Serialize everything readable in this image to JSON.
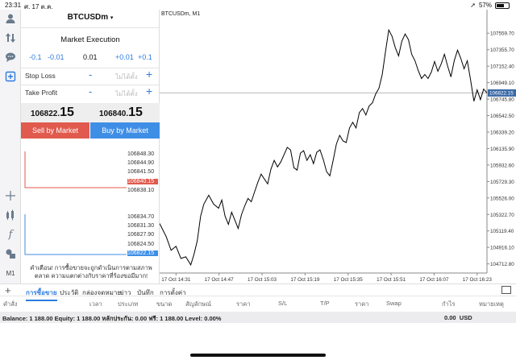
{
  "status_bar": {
    "time": "23:31",
    "date": "ศ. 17 ต.ค.",
    "battery": "57%",
    "battery_level": 0.57
  },
  "toolbar": {
    "timeframe_label": "M1"
  },
  "order_panel": {
    "symbol": "BTCUSDm",
    "caret": "▾",
    "execution": "Market Execution",
    "volume": {
      "dec_big": "-0.1",
      "dec_small": "-0.01",
      "value": "0.01",
      "inc_small": "+0.01",
      "inc_big": "+0.1"
    },
    "stop_loss": {
      "label": "Stop Loss",
      "minus": "-",
      "placeholder": "ไม่ได้ตั้ง",
      "plus": "+"
    },
    "take_profit": {
      "label": "Take Profit",
      "minus": "-",
      "placeholder": "ไม่ได้ตั้ง",
      "plus": "+"
    },
    "bid": {
      "main": "106822.",
      "big": "15"
    },
    "ask": {
      "main": "106840.",
      "big": "15"
    },
    "sell_button": "Sell by Market",
    "buy_button": "Buy by Market",
    "ask_ticks": [
      "106848.30",
      "106844.90",
      "106841.50",
      "106840.15",
      "106838.10"
    ],
    "bid_ticks": [
      "106834.70",
      "106831.30",
      "106827.90",
      "106824.50",
      "106822.15"
    ],
    "warning": "คำเตือน! การซื้อขายจะถูกดำเนินการตามสภาพตลาด ความแตกต่างกับราคาที่ร้องขอมีมาก!"
  },
  "chart": {
    "title": "BTCUSDm, M1",
    "current_price_label": "106822.15",
    "colors": {
      "line": "#000000",
      "price_line": "#b9b9b9",
      "price_tag": "#3b6aa8"
    }
  },
  "chart_data": {
    "type": "line",
    "title": "BTCUSDm, M1",
    "y_ticks": [
      "107559.70",
      "107355.70",
      "107152.40",
      "106949.10",
      "106745.80",
      "106542.50",
      "106339.20",
      "106135.90",
      "105932.60",
      "105729.30",
      "105526.00",
      "105322.70",
      "105119.40",
      "104916.10",
      "104712.80"
    ],
    "x_ticks": [
      "17 Oct 14:31",
      "17 Oct 14:47",
      "17 Oct 15:03",
      "17 Oct 15:19",
      "17 Oct 15:35",
      "17 Oct 15:51",
      "17 Oct 16:07",
      "17 Oct 16:23"
    ],
    "ylim": [
      104600,
      107850
    ],
    "x_range": [
      0,
      100
    ],
    "series": [
      {
        "values": [
          [
            0,
            105210
          ],
          [
            2,
            105050
          ],
          [
            3.5,
            104880
          ],
          [
            5,
            104930
          ],
          [
            6.5,
            104780
          ],
          [
            8,
            104800
          ],
          [
            9.5,
            104700
          ],
          [
            10.5,
            104830
          ],
          [
            11.5,
            105000
          ],
          [
            12.5,
            105300
          ],
          [
            13.5,
            105450
          ],
          [
            15,
            105560
          ],
          [
            16.5,
            105450
          ],
          [
            18,
            105400
          ],
          [
            19,
            105500
          ],
          [
            20,
            105300
          ],
          [
            21,
            105200
          ],
          [
            22,
            105350
          ],
          [
            23,
            105250
          ],
          [
            24,
            105150
          ],
          [
            25,
            105320
          ],
          [
            26,
            105430
          ],
          [
            27,
            105520
          ],
          [
            28,
            105480
          ],
          [
            29,
            105600
          ],
          [
            30,
            105720
          ],
          [
            31,
            105820
          ],
          [
            32,
            105760
          ],
          [
            33,
            105700
          ],
          [
            34,
            105880
          ],
          [
            35,
            105990
          ],
          [
            36,
            105910
          ],
          [
            37,
            105970
          ],
          [
            38,
            106060
          ],
          [
            39,
            106150
          ],
          [
            40,
            106120
          ],
          [
            41,
            105900
          ],
          [
            42,
            105870
          ],
          [
            43,
            106080
          ],
          [
            44,
            106110
          ],
          [
            45,
            105990
          ],
          [
            46,
            106060
          ],
          [
            47,
            105950
          ],
          [
            48,
            106090
          ],
          [
            49,
            106120
          ],
          [
            50,
            106000
          ],
          [
            51,
            105850
          ],
          [
            52,
            105800
          ],
          [
            53,
            105990
          ],
          [
            54,
            106190
          ],
          [
            55,
            106300
          ],
          [
            56,
            106230
          ],
          [
            57,
            106210
          ],
          [
            58,
            106390
          ],
          [
            59,
            106460
          ],
          [
            60,
            106390
          ],
          [
            61,
            106580
          ],
          [
            62,
            106630
          ],
          [
            63,
            106550
          ],
          [
            64,
            106660
          ],
          [
            65,
            106700
          ],
          [
            66,
            106810
          ],
          [
            67,
            106880
          ],
          [
            68,
            107050
          ],
          [
            69,
            107330
          ],
          [
            70,
            107600
          ],
          [
            71,
            107520
          ],
          [
            72,
            107380
          ],
          [
            73,
            107280
          ],
          [
            74,
            107460
          ],
          [
            75,
            107550
          ],
          [
            76,
            107480
          ],
          [
            77,
            107300
          ],
          [
            78,
            107220
          ],
          [
            79,
            107100
          ],
          [
            80,
            107000
          ],
          [
            81,
            107050
          ],
          [
            82,
            107000
          ],
          [
            83,
            107080
          ],
          [
            84,
            107210
          ],
          [
            85,
            107090
          ],
          [
            86,
            107180
          ],
          [
            87,
            107300
          ],
          [
            88,
            107150
          ],
          [
            89,
            107020
          ],
          [
            90,
            107220
          ],
          [
            91,
            107350
          ],
          [
            92,
            107250
          ],
          [
            93,
            107120
          ],
          [
            94,
            107220
          ],
          [
            95,
            106980
          ],
          [
            96,
            106720
          ],
          [
            97,
            106860
          ],
          [
            98,
            106740
          ],
          [
            99,
            106870
          ],
          [
            100,
            106822
          ]
        ]
      }
    ],
    "current_price": 106822.15
  },
  "terminal": {
    "add": "+",
    "tabs": [
      "การซื้อขาย",
      "ประวัติ",
      "กล่องจดหมาย",
      "ข่าว",
      "บันทึก",
      "การตั้งค่า"
    ],
    "columns": [
      "คำสั่ง",
      "เวลา",
      "ประเภท",
      "ขนาด",
      "สัญลักษณ์",
      "ราคา",
      "S/L",
      "T/P",
      "ราคา",
      "Swap",
      "กำไร",
      "หมายเหตุ"
    ],
    "balance_line": "Balance: 1 188.00 Equity: 1 188.00 หลักประกัน: 0.00 ฟรี: 1 188.00 Level: 0.00%",
    "profit": "0.00",
    "currency": "USD"
  }
}
